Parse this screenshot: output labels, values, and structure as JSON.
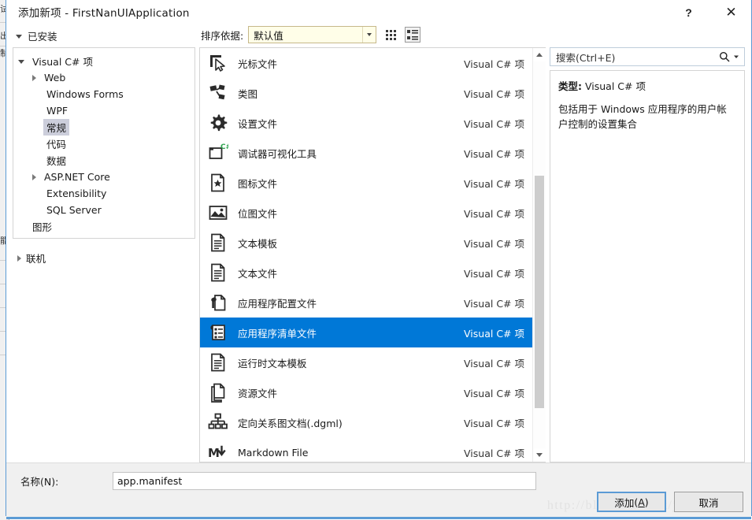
{
  "window": {
    "title": "添加新项 - FirstNanUIApplication",
    "help_label": "?",
    "close_label": "✕"
  },
  "toolbar": {
    "installed_label": "已安装",
    "sortby_label": "排序依据:",
    "sortby_value": "默认值",
    "grid_view_name": "grid-view",
    "list_view_name": "list-view"
  },
  "search": {
    "placeholder": "搜索(Ctrl+E)"
  },
  "tree": {
    "nodes": [
      {
        "label": "Visual C# 项",
        "depth": 0,
        "arrow": "open",
        "selected": false
      },
      {
        "label": "Web",
        "depth": 1,
        "arrow": "closed",
        "selected": false
      },
      {
        "label": "Windows Forms",
        "depth": 1,
        "arrow": "none",
        "selected": false
      },
      {
        "label": "WPF",
        "depth": 1,
        "arrow": "none",
        "selected": false
      },
      {
        "label": "常规",
        "depth": 1,
        "arrow": "none",
        "selected": true
      },
      {
        "label": "代码",
        "depth": 1,
        "arrow": "none",
        "selected": false
      },
      {
        "label": "数据",
        "depth": 1,
        "arrow": "none",
        "selected": false
      },
      {
        "label": "ASP.NET Core",
        "depth": 1,
        "arrow": "closed",
        "selected": false
      },
      {
        "label": "Extensibility",
        "depth": 1,
        "arrow": "none",
        "selected": false
      },
      {
        "label": "SQL Server",
        "depth": 1,
        "arrow": "none",
        "selected": false
      },
      {
        "label": "图形",
        "depth": 0,
        "arrow": "none",
        "selected": false
      }
    ],
    "online_label": "联机"
  },
  "list": {
    "type_column": "Visual C# 项",
    "items": [
      {
        "title": "光标文件",
        "type": "Visual C# 项",
        "icon": "cursor-icon",
        "selected": false
      },
      {
        "title": "类图",
        "type": "Visual C# 项",
        "icon": "class-diagram-icon",
        "selected": false
      },
      {
        "title": "设置文件",
        "type": "Visual C# 项",
        "icon": "gear-icon",
        "selected": false
      },
      {
        "title": "调试器可视化工具",
        "type": "Visual C# 项",
        "icon": "debugger-visualizer-icon",
        "selected": false
      },
      {
        "title": "图标文件",
        "type": "Visual C# 项",
        "icon": "icon-file-icon",
        "selected": false
      },
      {
        "title": "位图文件",
        "type": "Visual C# 项",
        "icon": "bitmap-icon",
        "selected": false
      },
      {
        "title": "文本模板",
        "type": "Visual C# 项",
        "icon": "text-template-icon",
        "selected": false
      },
      {
        "title": "文本文件",
        "type": "Visual C# 项",
        "icon": "text-file-icon",
        "selected": false
      },
      {
        "title": "应用程序配置文件",
        "type": "Visual C# 项",
        "icon": "app-config-icon",
        "selected": false
      },
      {
        "title": "应用程序清单文件",
        "type": "Visual C# 项",
        "icon": "app-manifest-icon",
        "selected": true
      },
      {
        "title": "运行时文本模板",
        "type": "Visual C# 项",
        "icon": "runtime-text-template-icon",
        "selected": false
      },
      {
        "title": "资源文件",
        "type": "Visual C# 项",
        "icon": "resource-file-icon",
        "selected": false
      },
      {
        "title": "定向关系图文档(.dgml)",
        "type": "Visual C# 项",
        "icon": "directed-graph-icon",
        "selected": false
      },
      {
        "title": "Markdown File",
        "type": "Visual C# 项",
        "icon": "markdown-icon",
        "selected": false
      }
    ]
  },
  "description": {
    "type_label": "类型:",
    "type_value": "Visual C# 项",
    "text": "包括用于 Windows 应用程序的用户帐户控制的设置集合"
  },
  "bottom": {
    "name_label": "名称(N):",
    "name_value": "app.manifest",
    "add_button": "添加(A)",
    "add_button_plain": "添加",
    "add_button_accel": "A",
    "cancel_button": "取消",
    "watermark": "http://blog.csdn.net/jiaxiuchen"
  },
  "colors": {
    "selection_blue": "#0078d7",
    "tree_selection": "#cccedb",
    "frame_blue": "#5b9bd5",
    "combo_yellow": "#fffee8"
  }
}
